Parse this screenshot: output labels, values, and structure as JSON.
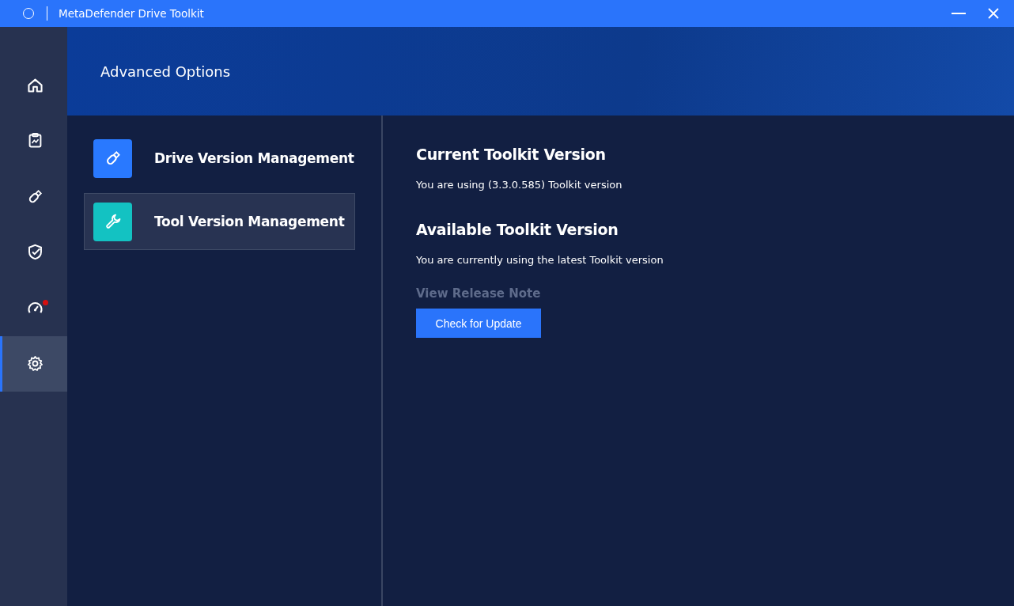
{
  "window": {
    "title": "MetaDefender Drive Toolkit"
  },
  "nav": [
    {
      "kind": "home",
      "selected": false,
      "notification": false
    },
    {
      "kind": "report",
      "selected": false,
      "notification": false
    },
    {
      "kind": "drive",
      "selected": false,
      "notification": false
    },
    {
      "kind": "shield",
      "selected": false,
      "notification": false
    },
    {
      "kind": "gauge",
      "selected": false,
      "notification": true
    },
    {
      "kind": "settings",
      "selected": true,
      "notification": false
    }
  ],
  "header": {
    "title": "Advanced Options"
  },
  "options": [
    {
      "kind": "drive",
      "label": "Drive Version Management",
      "color": "#2979ff",
      "selected": false
    },
    {
      "kind": "tool",
      "label": "Tool Version Management",
      "color": "#13c2c2",
      "selected": true
    }
  ],
  "details": {
    "current_heading": "Current Toolkit Version",
    "current_text": "You are using (3.3.0.585) Toolkit version",
    "available_heading": "Available Toolkit Version",
    "available_text": "You are currently using the latest Toolkit version",
    "release_note_link": "View Release Note",
    "check_button": "Check for Update"
  }
}
